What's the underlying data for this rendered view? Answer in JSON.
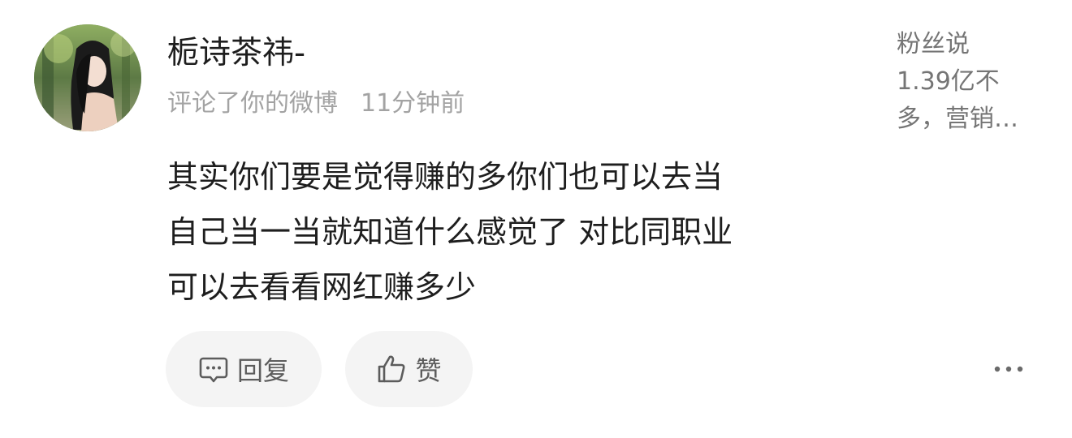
{
  "comment": {
    "username": "栀诗茶祎-",
    "action": "评论了你的微博",
    "time": "11分钟前",
    "lines": [
      "其实你们要是觉得赚的多你们也可以去当",
      "自己当一当就知道什么感觉了 对比同职业",
      "可以去看看网红赚多少"
    ]
  },
  "linked_post": {
    "lines": [
      "粉丝说",
      "1.39亿不",
      "多，营销…"
    ]
  },
  "actions": {
    "reply_label": "回复",
    "like_label": "赞"
  },
  "icons": {
    "avatar": "user-avatar-photo",
    "reply": "comment-bubble-icon",
    "like": "thumbs-up-icon",
    "more": "more-dots-icon"
  },
  "colors": {
    "text_primary": "#1e1e1e",
    "text_secondary": "#a3a3a3",
    "button_bg": "#f4f4f4"
  }
}
